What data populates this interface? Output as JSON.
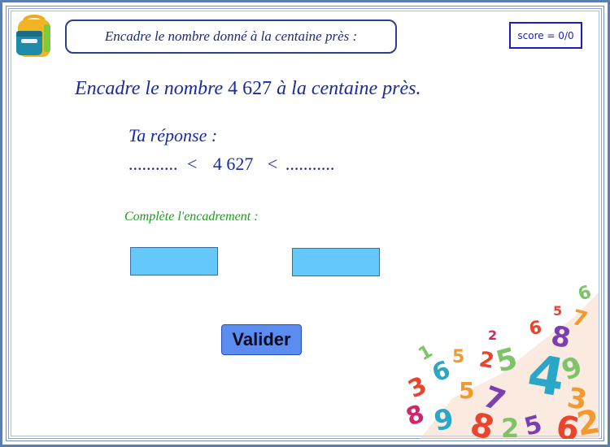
{
  "header": {
    "instruction": "Encadre le nombre donné à la centaine près :",
    "score": "score = 0/0"
  },
  "question": {
    "prefix": "Encadre le nombre",
    "number": "4 627",
    "suffix": "à la centaine près."
  },
  "answer": {
    "title": "Ta réponse :",
    "left_dots": "...........",
    "lt1": "<",
    "number": "4 627",
    "lt2": "<",
    "right_dots": "..........."
  },
  "hint": "Complète l'encadrement :",
  "inputs": {
    "lower": "",
    "upper": ""
  },
  "validate_label": "Valider",
  "colors": {
    "input_fill": "#64c8fa",
    "button_fill": "#5b8df0",
    "text_blue": "#1a2aa0",
    "hint_green": "#1f9a1f",
    "frame": "#5b7eb0"
  },
  "icons": [
    "backpack-icon",
    "numbers-pile-image"
  ]
}
